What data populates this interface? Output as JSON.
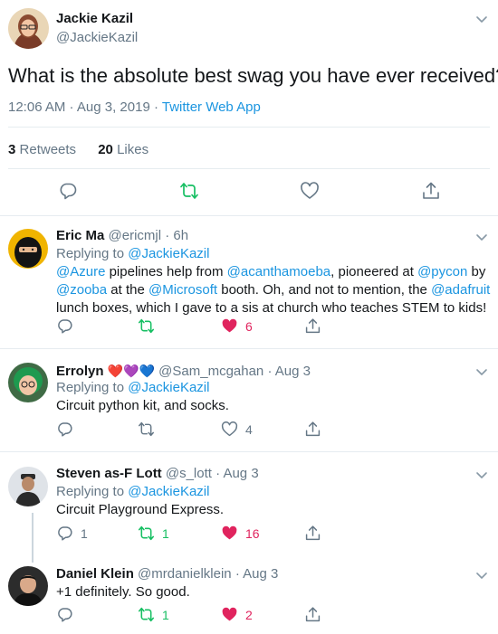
{
  "main_tweet": {
    "author_name": "Jackie Kazil",
    "author_handle": "@JackieKazil",
    "text": "What is the absolute best swag you have ever received?",
    "time": "12:06 AM · Aug 3, 2019",
    "sep": " · ",
    "source": "Twitter Web App",
    "retweets_count": "3",
    "retweets_label": "Retweets",
    "likes_count": "20",
    "likes_label": "Likes"
  },
  "replies": [
    {
      "name": "Eric Ma",
      "handle": "@ericmjl",
      "time": "· 6h",
      "replying_prefix": "Replying to",
      "replying_to": "@JackieKazil",
      "text_parts": {
        "m1": "@Azure",
        "t1": " pipelines help from ",
        "m2": "@acanthamoeba",
        "t2": ", pioneered at ",
        "m3": "@pycon",
        "t3": " by ",
        "m4": "@zooba",
        "t4": " at the ",
        "m5": "@Microsoft",
        "t5": " booth. Oh, and not to mention, the ",
        "m6": "@adafruit",
        "t6": " lunch boxes, which I gave to a sis at church who teaches STEM to kids!"
      },
      "reply_count": "",
      "retweet_count": "",
      "like_count": "6",
      "liked": true
    },
    {
      "name": "Errolyn",
      "emojis": "❤️💜💙",
      "handle": "@Sam_mcgahan",
      "time": "· Aug 3",
      "replying_prefix": "Replying to",
      "replying_to": "@JackieKazil",
      "text": "Circuit python kit, and socks.",
      "reply_count": "",
      "retweet_count": "",
      "like_count": "4",
      "liked": false
    },
    {
      "name": "Steven as-F Lott",
      "handle": "@s_lott",
      "time": "· Aug 3",
      "replying_prefix": "Replying to",
      "replying_to": "@JackieKazil",
      "text": "Circuit Playground Express.",
      "reply_count": "1",
      "retweet_count": "1",
      "like_count": "16",
      "liked": true
    },
    {
      "name": "Daniel Klein",
      "handle": "@mrdanielklein",
      "time": "· Aug 3",
      "text": "+1 definitely. So good.",
      "reply_count": "",
      "retweet_count": "1",
      "like_count": "2",
      "liked": true
    }
  ],
  "colors": {
    "accent": "#1b95e0",
    "retweet_green": "#17bf63",
    "like_red": "#e0245e",
    "gray": "#657786"
  },
  "icons": [
    "reply-icon",
    "retweet-icon",
    "like-icon",
    "share-icon",
    "chevron-down-icon"
  ]
}
